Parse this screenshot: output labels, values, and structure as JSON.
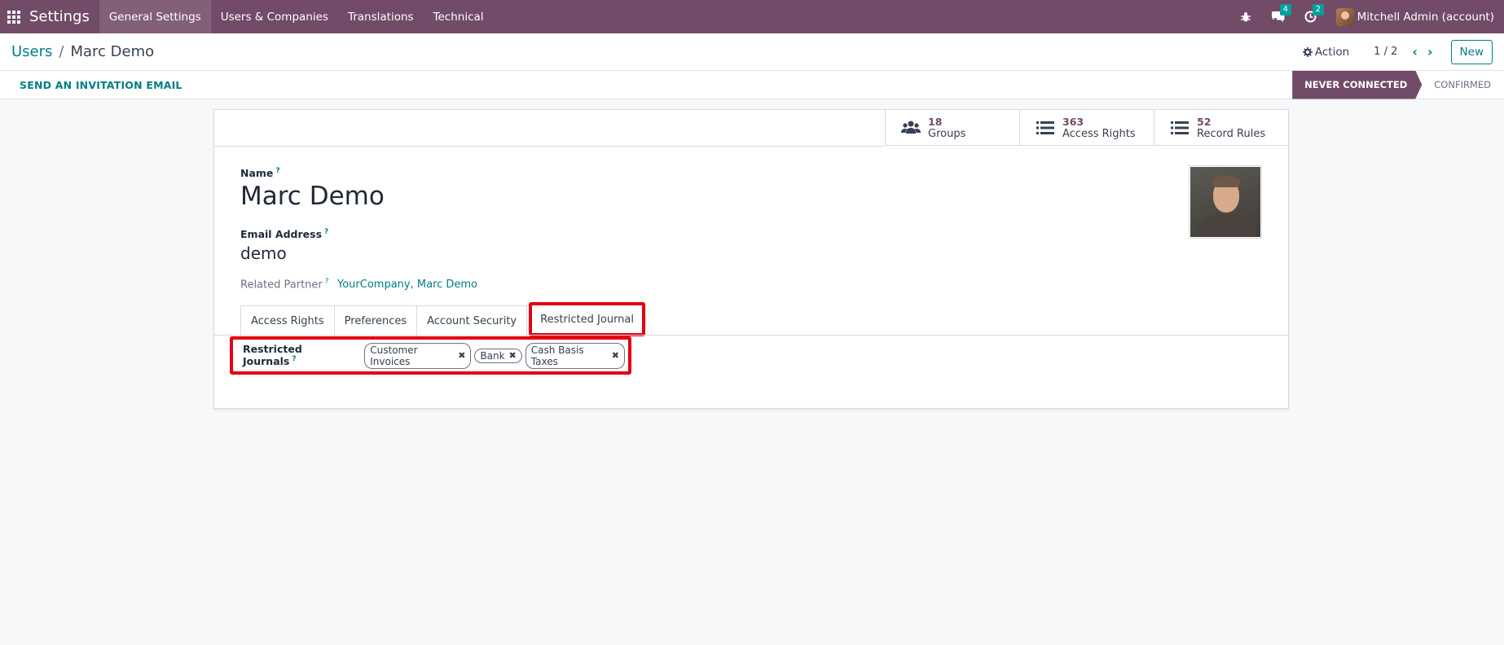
{
  "navbar": {
    "app_name": "Settings",
    "menu": [
      "General Settings",
      "Users & Companies",
      "Translations",
      "Technical"
    ],
    "messages_badge": "4",
    "activities_badge": "2",
    "user_name": "Mitchell Admin (account)"
  },
  "control_panel": {
    "breadcrumb_parent": "Users",
    "breadcrumb_separator": "/",
    "breadcrumb_current": "Marc Demo",
    "action_label": "Action",
    "pager": "1 / 2",
    "new_label": "New"
  },
  "statusbar": {
    "invite_label": "SEND AN INVITATION EMAIL",
    "stages": [
      "NEVER CONNECTED",
      "CONFIRMED"
    ]
  },
  "smart_buttons": [
    {
      "value": "18",
      "label": "Groups",
      "icon": "users-icon"
    },
    {
      "value": "363",
      "label": "Access Rights",
      "icon": "list-icon"
    },
    {
      "value": "52",
      "label": "Record Rules",
      "icon": "list-icon"
    }
  ],
  "form": {
    "name_label": "Name",
    "name_value": "Marc Demo",
    "email_label": "Email Address",
    "email_value": "demo",
    "partner_label": "Related Partner",
    "partner_value": "YourCompany, Marc Demo",
    "tooltip_mark": "?"
  },
  "tabs": [
    "Access Rights",
    "Preferences",
    "Account Security",
    "Restricted Journal"
  ],
  "restricted_journals": {
    "label": "Restricted Journals",
    "tags": [
      "Customer Invoices",
      "Bank",
      "Cash Basis Taxes"
    ]
  },
  "colors": {
    "brand": "#714b67",
    "accent": "#017e84",
    "highlight": "#e3000f"
  }
}
